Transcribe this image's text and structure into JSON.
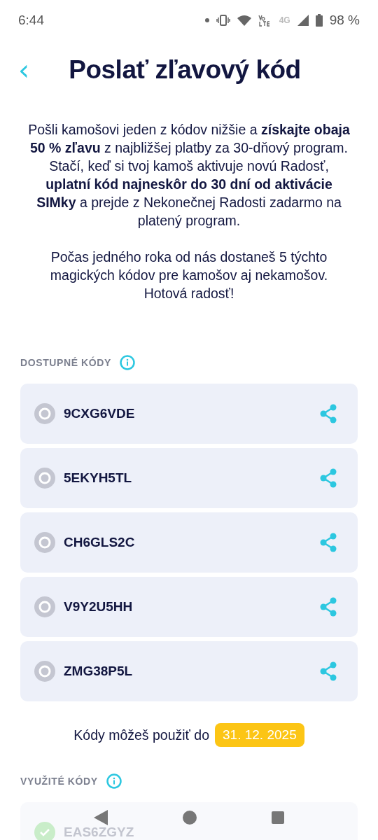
{
  "status_bar": {
    "time": "6:44",
    "network": "4G",
    "battery": "98 %"
  },
  "header": {
    "back": "‹",
    "title": "Poslať zľavový kód"
  },
  "intro": [
    "Pošli kamošovi jeden z kódov nižšie a **získajte obaja 50 % zľavu** z najbližšej platby za 30-dňový program. Stačí, keď si tvoj kamoš aktivuje novú Radosť, **uplatní kód najneskôr do 30 dní od aktivácie SIMky** a prejde z Nekonečnej Radosti zadarmo na platený program.",
    "Počas jedného roka od nás dostaneš 5 týchto magických kódov pre kamošov aj nekamošov. Hotová radosť!"
  ],
  "available": {
    "label": "DOSTUPNÉ KÓDY",
    "codes": [
      {
        "code": "9CXG6VDE",
        "used": false
      },
      {
        "code": "5EKYH5TL",
        "used": false
      },
      {
        "code": "CH6GLS2C",
        "used": false
      },
      {
        "code": "V9Y2U5HH",
        "used": false
      },
      {
        "code": "ZMG38P5L",
        "used": false
      }
    ]
  },
  "validity": {
    "text": "Kódy môžeš použiť do",
    "date": "31. 12. 2025"
  },
  "used": {
    "label": "VYUŽITÉ KÓDY",
    "codes": [
      {
        "code": "EAS6ZGYZ",
        "used": true
      }
    ]
  }
}
